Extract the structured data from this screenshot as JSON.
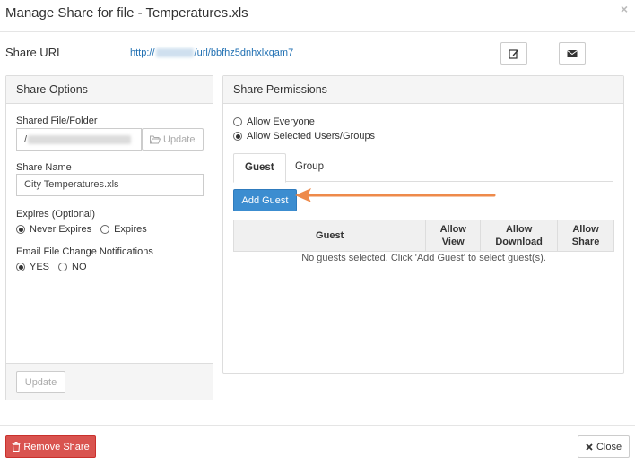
{
  "dialog": {
    "title": "Manage Share for file - Temperatures.xls",
    "close_glyph": "×"
  },
  "share_url": {
    "label": "Share URL",
    "prefix": "http://",
    "suffix": "/url/bbfhz5dnhxlxqam7"
  },
  "share_options": {
    "heading": "Share Options",
    "shared_file_label": "Shared File/Folder",
    "shared_file_value_prefix": "/",
    "update_inline_label": "Update",
    "share_name_label": "Share Name",
    "share_name_value": "City Temperatures.xls",
    "expires_label": "Expires (Optional)",
    "expires_options": [
      "Never Expires",
      "Expires"
    ],
    "expires_selected": "Never Expires",
    "notify_label": "Email File Change Notifications",
    "notify_options": [
      "YES",
      "NO"
    ],
    "notify_selected": "YES",
    "footer_update_label": "Update"
  },
  "share_permissions": {
    "heading": "Share Permissions",
    "scope_options": [
      "Allow Everyone",
      "Allow Selected Users/Groups"
    ],
    "scope_selected": "Allow Selected Users/Groups",
    "tabs": [
      "Guest",
      "Group"
    ],
    "active_tab": "Guest",
    "add_guest_label": "Add Guest",
    "columns": {
      "guest": "Guest",
      "allow_view_1": "Allow",
      "allow_view_2": "View",
      "allow_download_1": "Allow",
      "allow_download_2": "Download",
      "allow_share_1": "Allow",
      "allow_share_2": "Share"
    },
    "empty_message": "No guests selected. Click 'Add Guest' to select guest(s)."
  },
  "footer": {
    "remove_label": "Remove Share",
    "close_label": "Close"
  },
  "colors": {
    "primary": "#3c8dd0",
    "danger": "#d9534f",
    "link": "#1f6fb2",
    "arrow": "#ee8a4a"
  },
  "icons": [
    "close-icon",
    "edit-icon",
    "envelope-icon",
    "folder-open-icon",
    "trash-icon",
    "times-icon",
    "pointer-arrow"
  ]
}
